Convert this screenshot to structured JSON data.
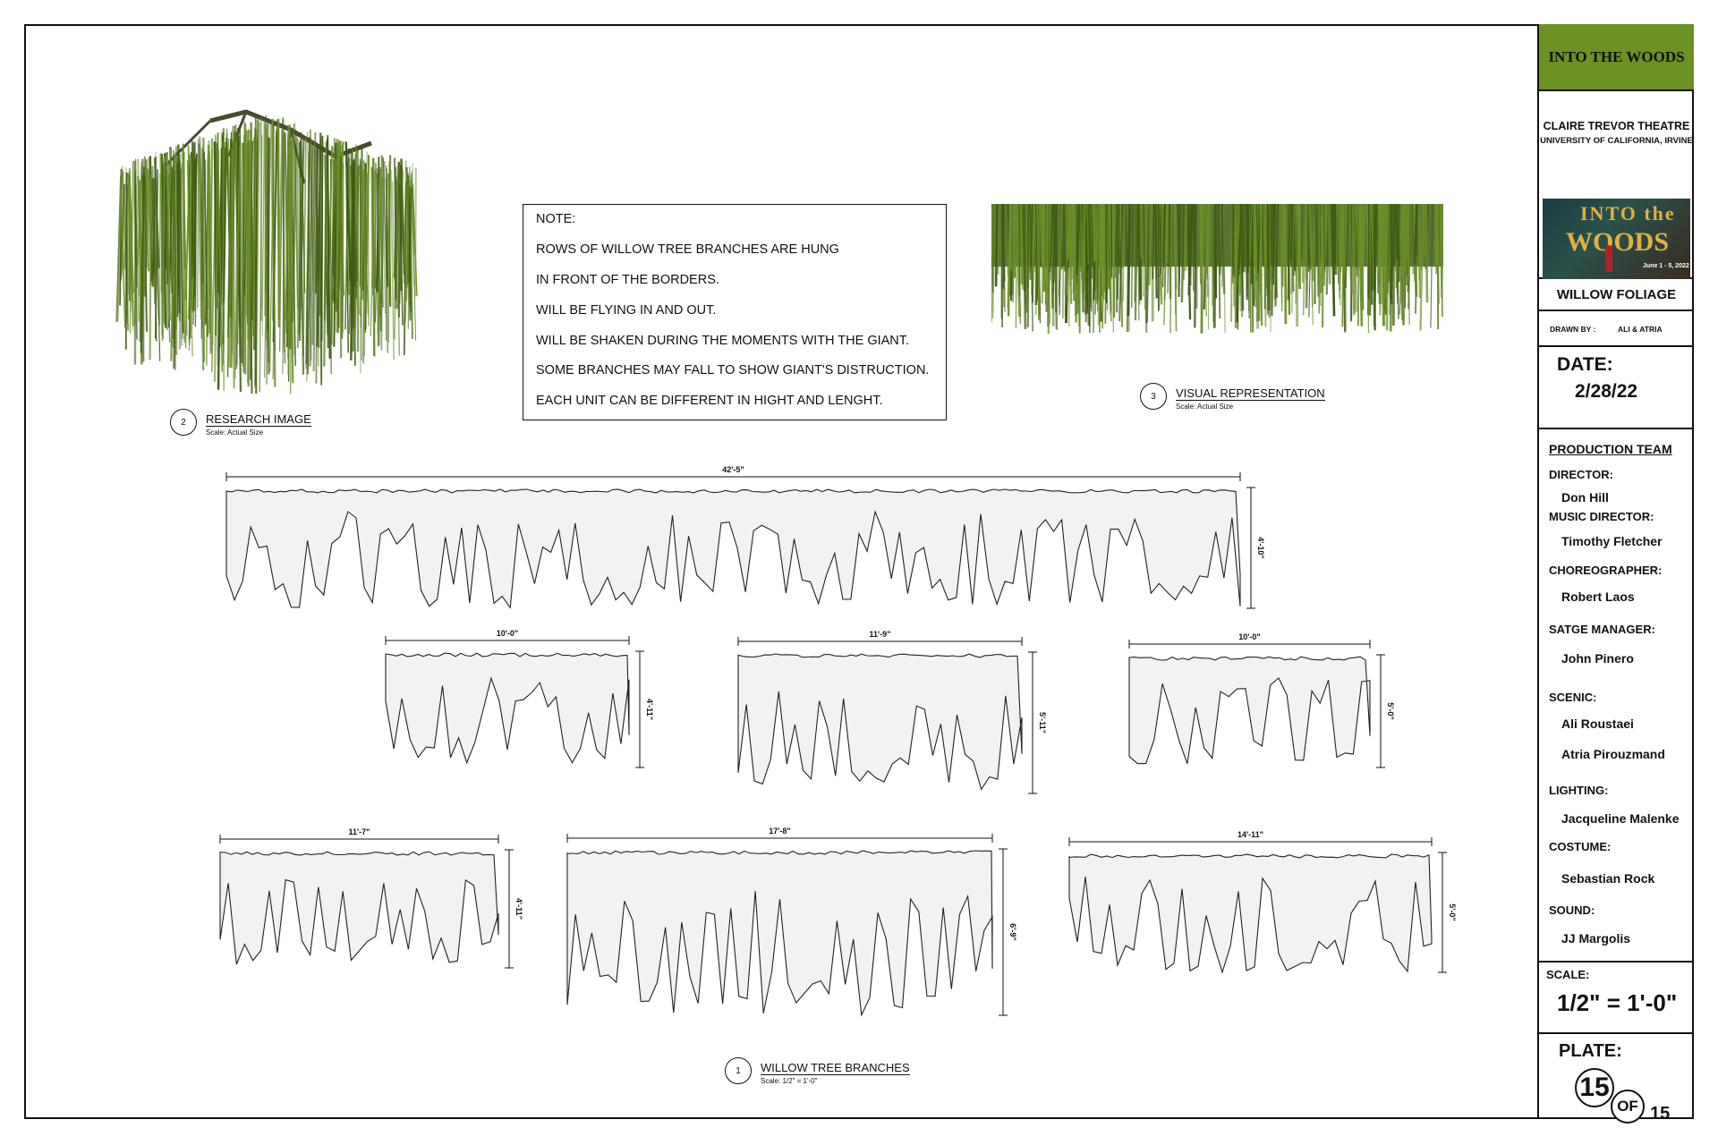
{
  "title_block": {
    "show_title": "INTO THE WOODS",
    "venue": "CLAIRE TREVOR THEATRE",
    "institution": "UNIVERSITY OF CALIFORNIA, IRVINE",
    "poster": {
      "title_line1": "INTO the",
      "title_line2": "WOODS",
      "dates": "June 1 - 5, 2022"
    },
    "sheet_title": "WILLOW FOLIAGE",
    "drawn_by_label": "DRAWN BY :",
    "drawn_by": "ALI & ATRIA",
    "date_label": "DATE:",
    "date": "2/28/22",
    "production_team_heading": "PRODUCTION TEAM",
    "team": [
      {
        "role": "DIRECTOR:",
        "names": [
          "Don Hill"
        ]
      },
      {
        "role": "MUSIC DIRECTOR:",
        "names": [
          "Timothy Fletcher"
        ]
      },
      {
        "role": "CHOREOGRAPHER:",
        "names": [
          "Robert Laos"
        ]
      },
      {
        "role": "SATGE MANAGER:",
        "names": [
          "John Pinero"
        ]
      },
      {
        "role": "SCENIC:",
        "names": [
          "Ali Roustaei",
          "Atria Pirouzmand"
        ]
      },
      {
        "role": "LIGHTING:",
        "names": [
          "Jacqueline Malenke"
        ]
      },
      {
        "role": "COSTUME:",
        "names": [
          "Sebastian Rock"
        ]
      },
      {
        "role": "SOUND:",
        "names": [
          "JJ Margolis"
        ]
      }
    ],
    "scale_label": "SCALE:",
    "scale": "1/2\" = 1'-0\"",
    "plate_label": "PLATE:",
    "plate_number": "15",
    "plate_of": "OF",
    "plate_total": "15"
  },
  "note": {
    "heading": "NOTE:",
    "lines": [
      "ROWS OF WILLOW TREE BRANCHES ARE HUNG",
      "IN FRONT OF THE BORDERS.",
      "WILL BE FLYING IN AND OUT.",
      "WILL BE SHAKEN DURING THE MOMENTS WITH THE GIANT.",
      "SOME BRANCHES MAY FALL TO SHOW GIANT'S DISTRUCTION.",
      "EACH UNIT CAN BE DIFFERENT IN HIGHT AND LENGHT."
    ]
  },
  "callouts": [
    {
      "number": "2",
      "title": "RESEARCH IMAGE",
      "scale": "Scale: Actual Size"
    },
    {
      "number": "3",
      "title": "VISUAL REPRESENTATION",
      "scale": "Scale: Actual Size"
    },
    {
      "number": "1",
      "title": "WILLOW TREE BRANCHES",
      "scale": "Scale: 1/2\" = 1'-0\""
    }
  ],
  "units": [
    {
      "width": "42'-5\"",
      "height": "4'-10\""
    },
    {
      "width": "10'-0\"",
      "height": "4'-11\""
    },
    {
      "width": "11'-9\"",
      "height": "5'-11\""
    },
    {
      "width": "10'-0\"",
      "height": "5'-0\""
    },
    {
      "width": "11'-7\"",
      "height": "4'-11\""
    },
    {
      "width": "17'-8\"",
      "height": "6'-9\""
    },
    {
      "width": "14'-11\"",
      "height": "5'-0\""
    }
  ],
  "colors": {
    "foliage": "#6b8f2a",
    "foliage_dark": "#3f5a14",
    "title_green": "#6b9222",
    "unit_fill": "#f2f2f2"
  }
}
